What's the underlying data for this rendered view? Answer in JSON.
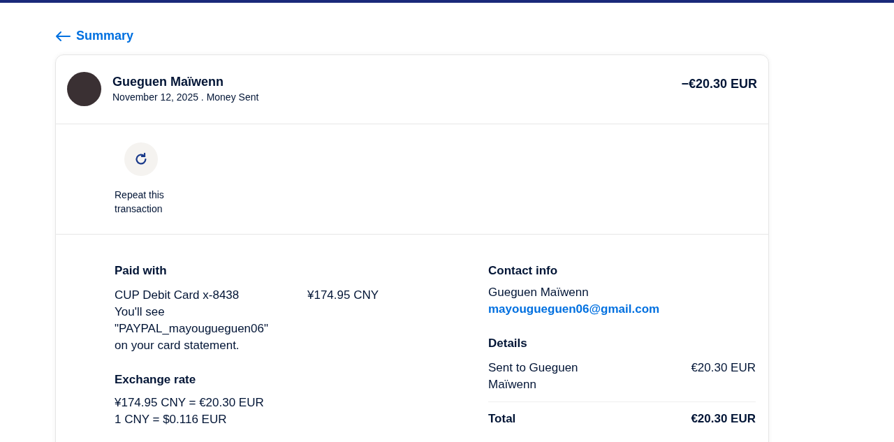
{
  "back_link": {
    "label": "Summary"
  },
  "header": {
    "name": "Gueguen Maïwenn",
    "subtitle": "November 12, 2025 . Money Sent",
    "amount": "−€20.30 EUR"
  },
  "actions": [
    {
      "label": "Repeat this transaction"
    }
  ],
  "paid_with": {
    "title": "Paid with",
    "card": "CUP Debit Card x-8438",
    "note": "You'll see \"PAYPAL_mayougueguen06\" on your card statement.",
    "amount": "¥174.95 CNY"
  },
  "exchange_rate": {
    "title": "Exchange rate",
    "lines": [
      "¥174.95 CNY = €20.30 EUR",
      "1 CNY = $0.116 EUR"
    ]
  },
  "contact_info": {
    "title": "Contact info",
    "name": "Gueguen Maïwenn",
    "email": "mayougueguen06@gmail.com"
  },
  "details": {
    "title": "Details",
    "rows": [
      {
        "label": "Sent to Gueguen Maïwenn",
        "value": "€20.30 EUR"
      }
    ],
    "total": {
      "label": "Total",
      "value": "€20.30 EUR"
    }
  }
}
